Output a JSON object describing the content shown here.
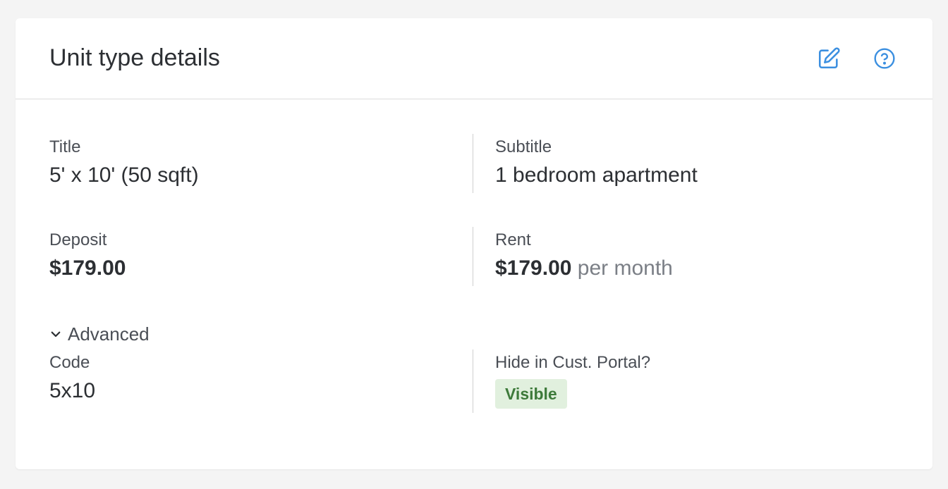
{
  "card": {
    "title": "Unit type details",
    "edit_icon": "edit-icon",
    "help_icon": "help-circle-icon"
  },
  "fields": {
    "title_label": "Title",
    "title_value": "5' x 10' (50 sqft)",
    "subtitle_label": "Subtitle",
    "subtitle_value": "1 bedroom apartment",
    "deposit_label": "Deposit",
    "deposit_value": "$179.00",
    "rent_label": "Rent",
    "rent_value": "$179.00",
    "rent_suffix": "per month"
  },
  "advanced": {
    "toggle_label": "Advanced",
    "code_label": "Code",
    "code_value": "5x10",
    "portal_label": "Hide in Cust. Portal?",
    "portal_badge": "Visible"
  },
  "colors": {
    "accent": "#3b8fe0",
    "badge_bg": "#e1f0de",
    "badge_text": "#3d7a3a"
  }
}
